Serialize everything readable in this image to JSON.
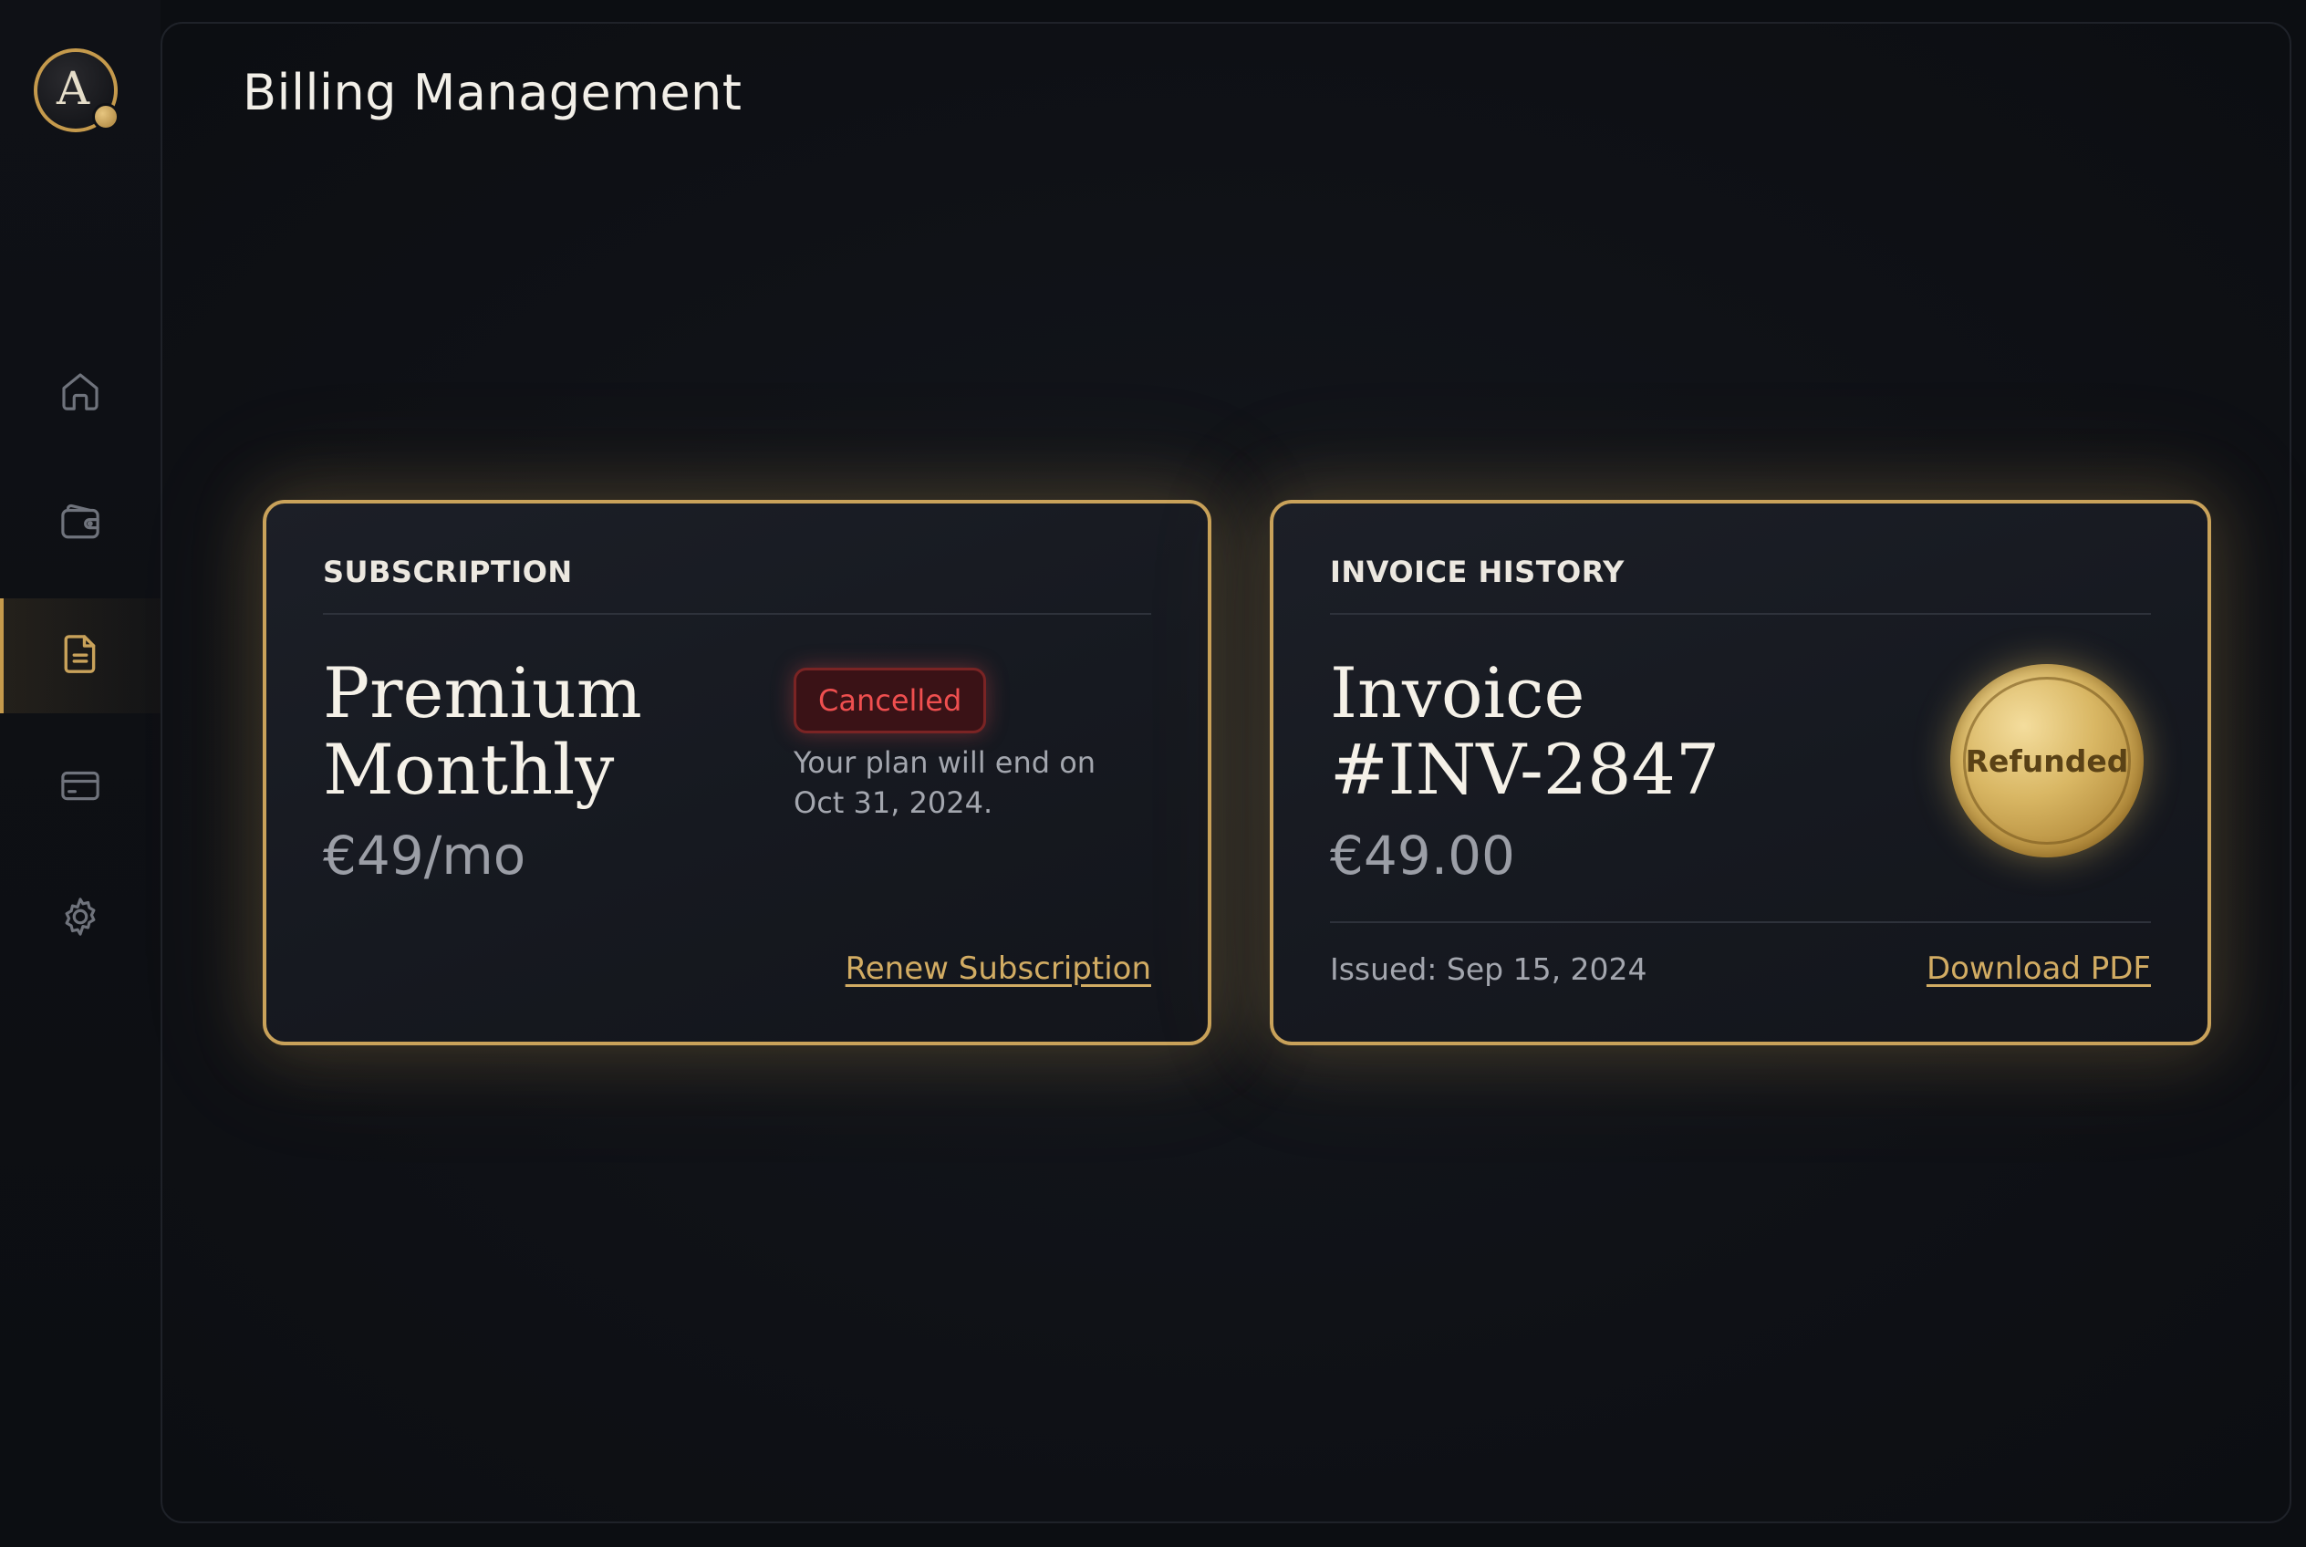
{
  "sidebar": {
    "logo_letter": "A",
    "nav": [
      {
        "id": "home",
        "icon": "home-icon",
        "active": false
      },
      {
        "id": "wallet",
        "icon": "wallet-icon",
        "active": false
      },
      {
        "id": "invoices",
        "icon": "document-icon",
        "active": true
      },
      {
        "id": "cards",
        "icon": "credit-card-icon",
        "active": false
      },
      {
        "id": "settings",
        "icon": "gear-icon",
        "active": false
      }
    ]
  },
  "header": {
    "title": "Billing Management"
  },
  "subscription": {
    "label": "SUBSCRIPTION",
    "plan_line1": "Premium",
    "plan_line2": "Monthly",
    "price": "€49/mo",
    "status": "Cancelled",
    "note": "Your plan will end on Oct 31, 2024.",
    "action": "Renew Subscription"
  },
  "invoice": {
    "label": "INVOICE HISTORY",
    "title_line1": "Invoice",
    "title_line2": "#INV-2847",
    "amount": "€49.00",
    "status": "Refunded",
    "issued": "Issued: Sep 15, 2024",
    "action": "Download PDF"
  },
  "colors": {
    "accent_gold": "#c9a25a",
    "danger": "#ef4f4f",
    "background": "#0c0e12"
  }
}
